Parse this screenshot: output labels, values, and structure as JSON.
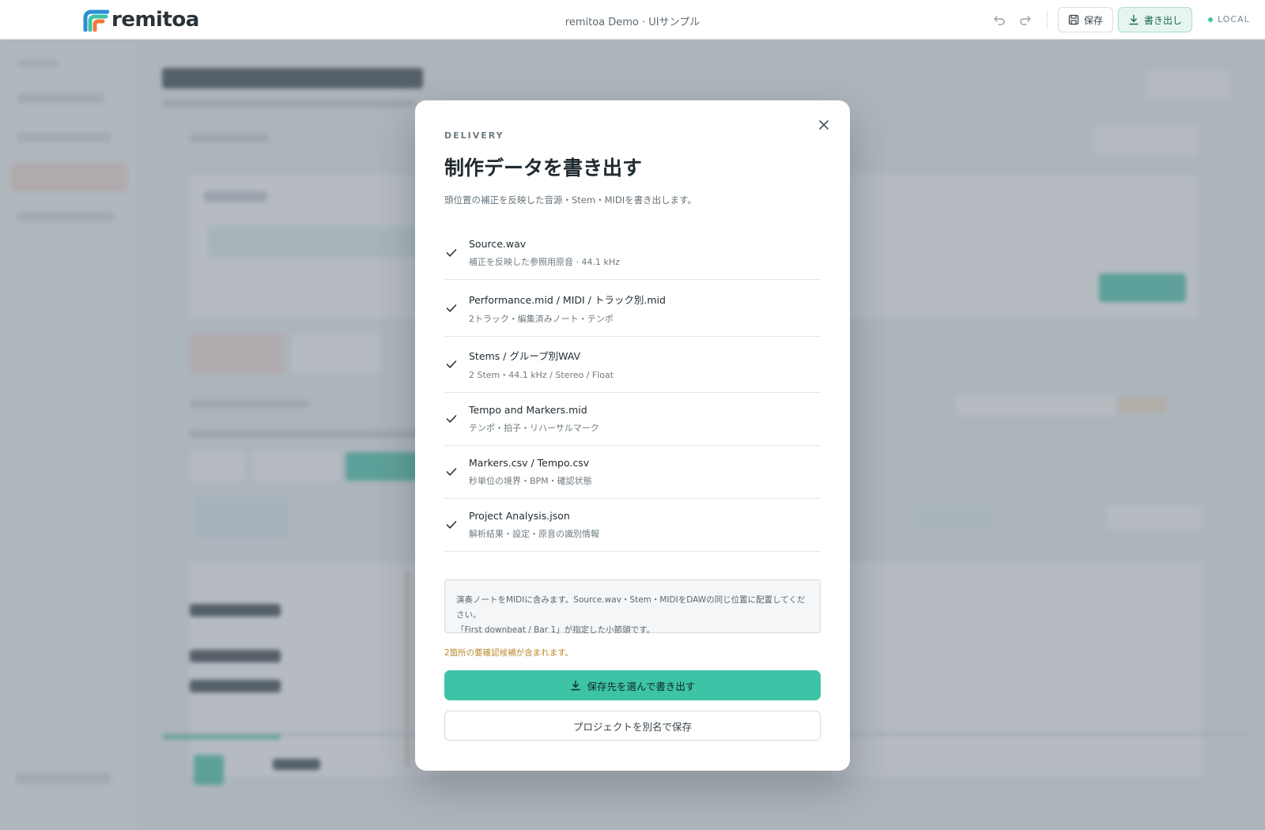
{
  "topbar": {
    "logo_text": "remitoa",
    "title": "remitoa Demo · UIサンプル",
    "undo_icon": "undo-icon",
    "redo_icon": "redo-icon",
    "save_label": "保存",
    "export_label": "書き出し",
    "status": "LOCAL"
  },
  "colors": {
    "accent": "#3dc4a6",
    "warning": "#b98a2e",
    "brand_orange": "#f07a3a",
    "brand_blue": "#2b8fd6",
    "brand_green": "#3dc4a6"
  },
  "modal": {
    "eyebrow": "DELIVERY",
    "title": "制作データを書き出す",
    "subtitle": "頭位置の補正を反映した音源・Stem・MIDIを書き出します。",
    "items": [
      {
        "name": "Source.wav",
        "desc": "補正を反映した参照用原音 · 44.1 kHz"
      },
      {
        "name": "Performance.mid / MIDI / トラック別.mid",
        "desc": "2トラック・編集済みノート・テンポ"
      },
      {
        "name": "Stems / グループ別WAV",
        "desc": "2 Stem・44.1 kHz / Stereo / Float"
      },
      {
        "name": "Tempo and Markers.mid",
        "desc": "テンポ・拍子・リハーサルマーク"
      },
      {
        "name": "Markers.csv / Tempo.csv",
        "desc": "秒単位の境界・BPM・確認状態"
      },
      {
        "name": "Project Analysis.json",
        "desc": "解析結果・設定・原音の識別情報"
      }
    ],
    "note_line1": "演奏ノートをMIDIに含みます。Source.wav・Stem・MIDIをDAWの同じ位置に配置してください。",
    "note_line2": "「First downbeat / Bar 1」が指定した小節頭です。",
    "warning": "2箇所の要確認候補が含まれます。",
    "primary_label": "保存先を選んで書き出す",
    "secondary_label": "プロジェクトを別名で保存"
  }
}
